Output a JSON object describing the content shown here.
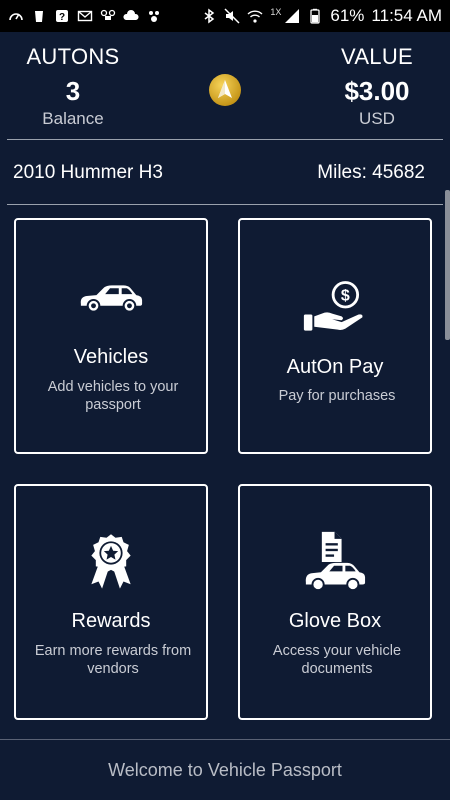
{
  "status_bar": {
    "battery_percent": "61%",
    "time": "11:54 AM",
    "signal_badge": "1X",
    "left_icons": [
      "speedometer-icon",
      "starbucks-icon",
      "help-icon",
      "mail-icon",
      "drone-icon",
      "weather-icon",
      "dog-icon"
    ],
    "right_icons": [
      "bluetooth-icon",
      "mute-icon",
      "wifi-icon",
      "signal-icon",
      "battery-icon"
    ]
  },
  "header": {
    "autons": {
      "title": "AUTONS",
      "value": "3",
      "sub": "Balance"
    },
    "value": {
      "title": "VALUE",
      "value": "$3.00",
      "sub": "USD"
    },
    "logo_icon": "auton-logo-icon"
  },
  "vehicle": {
    "name": "2010 Hummer H3",
    "miles": "Miles: 45682"
  },
  "tiles": [
    {
      "icon": "car-icon",
      "title": "Vehicles",
      "desc": "Add vehicles to your passport"
    },
    {
      "icon": "pay-hand-icon",
      "title": "AutOn Pay",
      "desc": "Pay for purchases"
    },
    {
      "icon": "award-ribbon-icon",
      "title": "Rewards",
      "desc": "Earn more rewards from vendors"
    },
    {
      "icon": "glovebox-document-icon",
      "title": "Glove Box",
      "desc": "Access your vehicle documents"
    }
  ],
  "footer": {
    "text": "Welcome to Vehicle Passport"
  },
  "colors": {
    "background": "#0f1b33",
    "logo_gold": "#e2b522",
    "tile_border": "#ffffff"
  }
}
